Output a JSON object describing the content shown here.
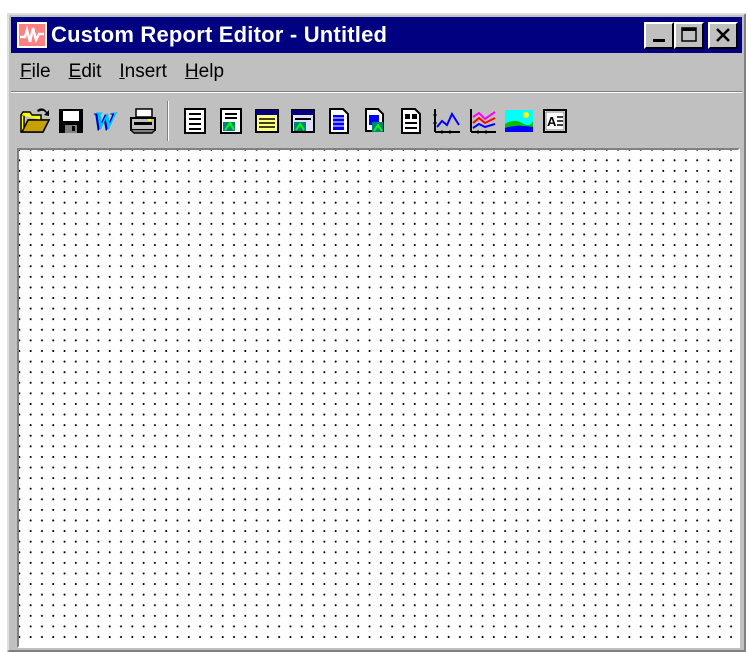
{
  "window": {
    "title": "Custom Report Editor - Untitled",
    "title_bar_color": "#000080",
    "chrome_color": "#c0c0c0",
    "caption_buttons": [
      "minimize-icon",
      "maximize-icon",
      "close-icon"
    ]
  },
  "menu": {
    "file": {
      "accel": "F",
      "rest": "ile"
    },
    "edit": {
      "accel": "E",
      "rest": "dit"
    },
    "insert": {
      "accel": "I",
      "rest": "nsert"
    },
    "help": {
      "accel": "H",
      "rest": "elp"
    }
  },
  "toolbar": {
    "file_group": [
      "open-folder-icon",
      "save-disk-icon",
      "word-export-icon",
      "print-icon"
    ],
    "insert_group": [
      "report-header-icon",
      "report-footer-icon",
      "page-header-icon",
      "page-footer-icon",
      "detail-section-icon",
      "sub-report-icon",
      "field-icon",
      "line-chart-icon",
      "multi-line-chart-icon",
      "image-icon",
      "text-box-icon"
    ]
  },
  "canvas": {
    "description_grid": "dotted-grid",
    "background": "#ffffff"
  }
}
